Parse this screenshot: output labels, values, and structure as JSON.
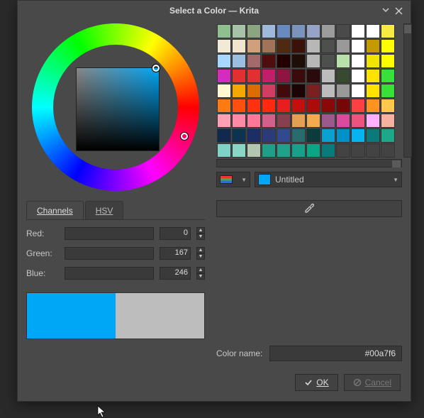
{
  "window": {
    "title": "Select a Color — Krita"
  },
  "tabs": {
    "channels": "Channels",
    "hsv": "HSV",
    "active": "channels"
  },
  "channels": {
    "red": {
      "label": "Red:",
      "value": "0"
    },
    "green": {
      "label": "Green:",
      "value": "167"
    },
    "blue": {
      "label": "Blue:",
      "value": "246"
    }
  },
  "current_color": "#00a7f6",
  "previous_color": "#bdbdbd",
  "color_name": {
    "label": "Color name:",
    "value": "#00a7f6"
  },
  "palette_selector": {
    "name": "Untitled"
  },
  "palette": [
    [
      "#8fbf8f",
      "#a7c3a7",
      "#8aa57f",
      "#9fb9d9",
      "#698abf",
      "#7a94bb",
      "#95a3c6",
      "#9c9c9c",
      "#4a4a4a",
      "#ffffff",
      "#ffffff",
      "#f7ea43"
    ],
    [
      "#f0ead6",
      "#f0e6cf",
      "#cfa07a",
      "#a17357",
      "#4f2a13",
      "#3a1207",
      "#b7b7b7",
      "#4d504d",
      "#999999",
      "#ffffff",
      "#c49a00",
      "#ffff00"
    ],
    [
      "#a7d8ff",
      "#9bbfe0",
      "#a6696b",
      "#4f0d0d",
      "#220000",
      "#1f0e07",
      "#b7b7b7",
      "#4d504d",
      "#b8e0a8",
      "#ffffff",
      "#f0e400",
      "#ffff00"
    ],
    [
      "#d42cc1",
      "#e22f2f",
      "#e22f2f",
      "#c21f6a",
      "#8f143f",
      "#3b0a0a",
      "#2a0a0a",
      "#bcbcbc",
      "#374a2f",
      "#ffffff",
      "#ffe200",
      "#38e038"
    ],
    [
      "#fff8d0",
      "#f3a800",
      "#dc6b00",
      "#d23d62",
      "#420a0a",
      "#1a0404",
      "#7a2020",
      "#bcbcbc",
      "#999999",
      "#ffffff",
      "#ffe200",
      "#38e038"
    ],
    [
      "#ff7a10",
      "#ff5010",
      "#ff3210",
      "#ff2810",
      "#e81e1e",
      "#c40f0f",
      "#ad0a0a",
      "#8a0808",
      "#770707",
      "#ff4040",
      "#ff9320",
      "#ffc84d"
    ],
    [
      "#ff9fb4",
      "#ff8aa7",
      "#ff7799",
      "#d1608a",
      "#87404f",
      "#e49f52",
      "#f4a850",
      "#9c5a8c",
      "#da4a9e",
      "#ec5480",
      "#ffb0ff",
      "#f6b1a0"
    ],
    [
      "#12294f",
      "#0e3350",
      "#1d2d66",
      "#2a3b78",
      "#314a8f",
      "#2a6b6b",
      "#0b3b3b",
      "#0aa0d0",
      "#0290c8",
      "#06b5f0",
      "#0a7a7a",
      "#1ea88a"
    ],
    [
      "#7fd3c6",
      "#8ad6c5",
      "#b2c6b0",
      "#1f9f88",
      "#1fa18a",
      "#18a088",
      "#0aa686",
      "#0a7a7a",
      "#434343",
      "#434343",
      "#434343",
      "#434343"
    ]
  ],
  "icons": {
    "palette": "palette-icon",
    "eyedropper": "eyedropper-icon",
    "check": "check-icon",
    "forbid": "forbidden-icon"
  },
  "buttons": {
    "ok": "OK",
    "cancel": "Cancel"
  }
}
